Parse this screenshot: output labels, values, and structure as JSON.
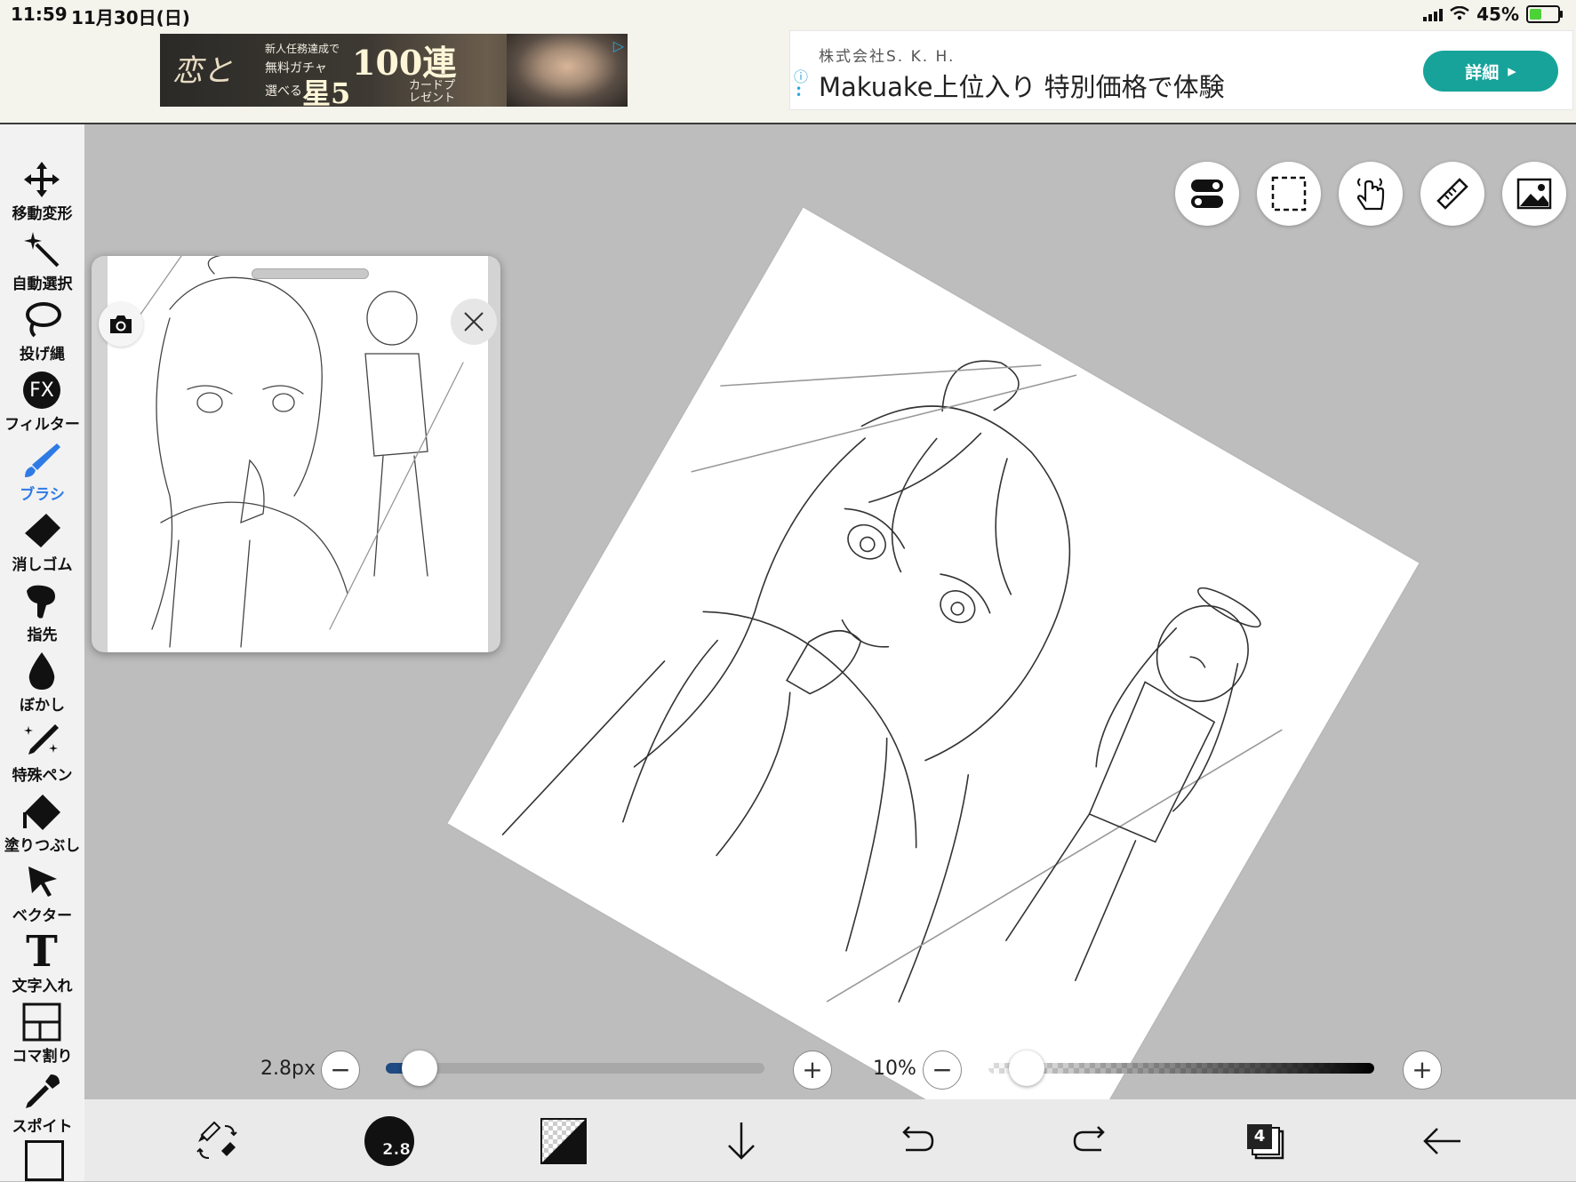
{
  "status_bar": {
    "time": "11:59",
    "date": "11月30日(日)",
    "battery": "45%",
    "battery_level": 0.45
  },
  "ads": {
    "left_banner": {
      "logo": "恋と",
      "line1": "新人任務達成で",
      "line2": "無料ガチャ",
      "big1": "100連",
      "line3": "選べる",
      "big2": "星5",
      "line4": "カードプレゼント"
    },
    "right_banner": {
      "company": "株式会社S. K. H.",
      "headline": "Makuake上位入り 特別価格で体験",
      "cta_label": "詳細",
      "accent_color": "#17a39a"
    }
  },
  "sidebar": {
    "tools": [
      {
        "label": "移動変形",
        "icon": "move-icon"
      },
      {
        "label": "自動選択",
        "icon": "magic-wand-icon"
      },
      {
        "label": "投げ縄",
        "icon": "lasso-icon"
      },
      {
        "label": "フィルター",
        "icon": "fx-icon",
        "icon_text": "FX"
      },
      {
        "label": "ブラシ",
        "icon": "brush-icon",
        "active": true
      },
      {
        "label": "消しゴム",
        "icon": "eraser-icon"
      },
      {
        "label": "指先",
        "icon": "finger-icon"
      },
      {
        "label": "ぼかし",
        "icon": "blur-drop-icon"
      },
      {
        "label": "特殊ペン",
        "icon": "special-pen-icon"
      },
      {
        "label": "塗りつぶし",
        "icon": "fill-bucket-icon"
      },
      {
        "label": "ベクター",
        "icon": "vector-cursor-icon"
      },
      {
        "label": "文字入れ",
        "icon": "text-tool-icon",
        "icon_text": "T"
      },
      {
        "label": "コマ割り",
        "icon": "panel-divide-icon"
      },
      {
        "label": "スポイト",
        "icon": "eyedropper-icon"
      }
    ],
    "active_color": "#2f7be5"
  },
  "canvas_buttons": [
    "toggle-icon",
    "selection-icon",
    "touch-icon",
    "ruler-icon",
    "image-icon"
  ],
  "navigator": {
    "camera_icon": "camera-icon",
    "close_icon": "close-icon"
  },
  "sliders": {
    "brush_size_label": "2.8px",
    "brush_size_fraction": 0.09,
    "opacity_label": "10%",
    "opacity_fraction": 0.1,
    "minus": "−",
    "plus": "+"
  },
  "bottom_bar": {
    "brush_size_badge": "2.8",
    "layer_count": "4",
    "primary_color": "#111111"
  }
}
